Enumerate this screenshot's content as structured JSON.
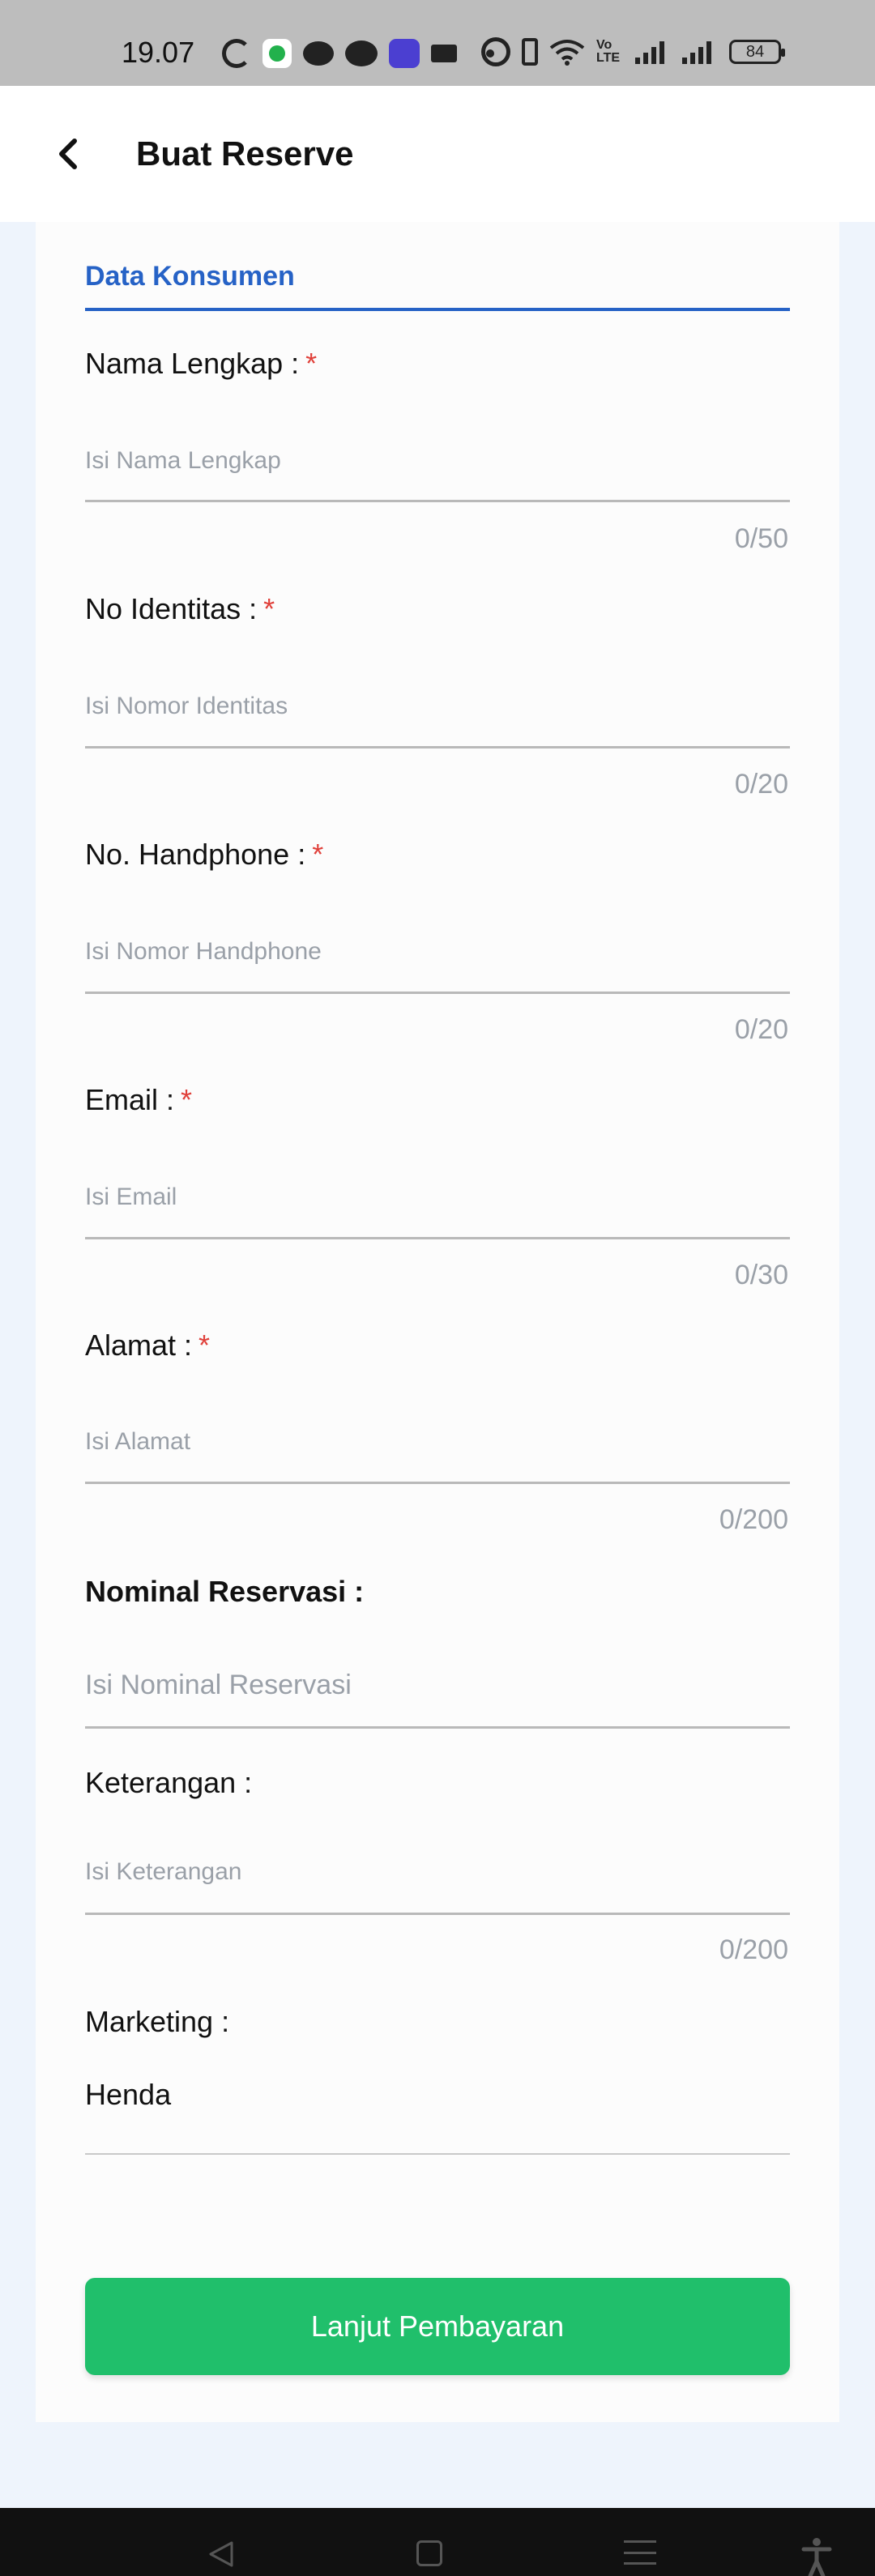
{
  "status_bar": {
    "time": "19.07",
    "icons": [
      "google-icon",
      "green-app-icon",
      "chat-bubble-icon",
      "line-app-icon",
      "discord-app-icon",
      "film-icon",
      "dot-icon",
      "alarm-icon",
      "vibrate-icon",
      "wifi-icon",
      "volte-icon",
      "signal-icon",
      "signal-icon",
      "battery-icon"
    ],
    "volte_label_top": "Vo",
    "volte_label_bottom": "LTE",
    "battery": "84"
  },
  "header": {
    "title": "Buat Reserve",
    "back_icon": "chevron-left-icon"
  },
  "section": {
    "title": "Data Konsumen"
  },
  "fields": {
    "nama": {
      "label": "Nama Lengkap :",
      "required_mark": "*",
      "placeholder": "Isi Nama Lengkap",
      "counter": "0/50"
    },
    "identitas": {
      "label": "No Identitas :",
      "required_mark": "*",
      "placeholder": "Isi Nomor Identitas",
      "counter": "0/20"
    },
    "handphone": {
      "label": "No. Handphone :",
      "required_mark": "*",
      "placeholder": "Isi Nomor Handphone",
      "counter": "0/20"
    },
    "email": {
      "label": "Email :",
      "required_mark": "*",
      "placeholder": "Isi Email",
      "counter": "0/30"
    },
    "alamat": {
      "label": "Alamat :",
      "required_mark": "*",
      "placeholder": "Isi Alamat",
      "counter": "0/200"
    },
    "nominal": {
      "label": "Nominal Reservasi :",
      "placeholder": "Isi Nominal Reservasi"
    },
    "keterangan": {
      "label": "Keterangan :",
      "placeholder": "Isi Keterangan",
      "counter": "0/200"
    },
    "marketing": {
      "label": "Marketing :",
      "value": "Henda"
    }
  },
  "submit_button": {
    "label": "Lanjut Pembayaran"
  },
  "colors": {
    "accent_blue": "#2662c6",
    "required_red": "#e0403a",
    "button_green": "#20bf6b",
    "page_bg": "#eef4fc"
  },
  "nav_bar": {
    "icons": [
      "back-triangle-icon",
      "home-square-icon",
      "menu-lines-icon",
      "accessibility-icon"
    ]
  }
}
